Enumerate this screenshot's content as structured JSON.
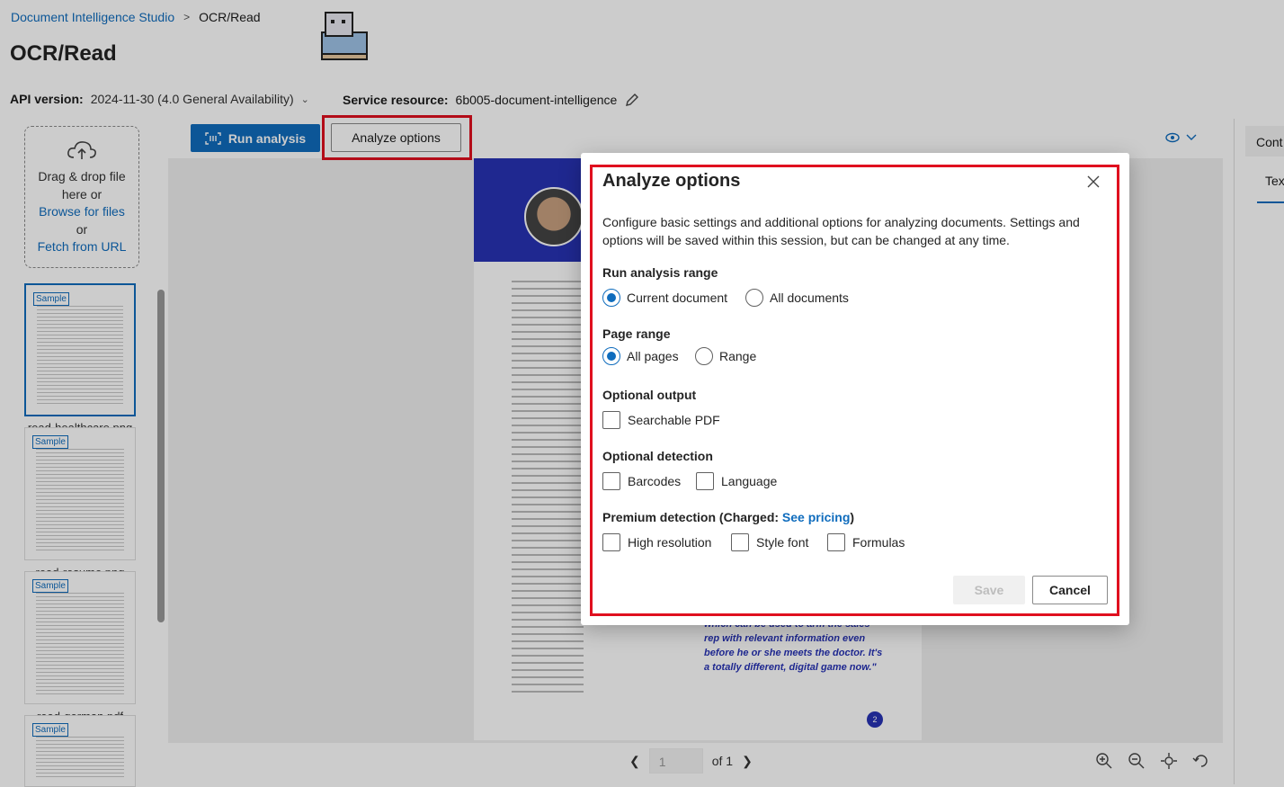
{
  "breadcrumb": {
    "root": "Document Intelligence Studio",
    "current": "OCR/Read"
  },
  "page_title": "OCR/Read",
  "api": {
    "label": "API version:",
    "value": "2024-11-30 (4.0 General Availability)"
  },
  "service": {
    "label": "Service resource:",
    "value": "6b005-document-intelligence"
  },
  "dropzone": {
    "line1": "Drag & drop file",
    "line2": "here or",
    "browse": "Browse for files",
    "or": "or",
    "fetch": "Fetch from URL"
  },
  "samples": [
    {
      "badge": "Sample",
      "name": "read-healthcare.png"
    },
    {
      "badge": "Sample",
      "name": "read-resume.png"
    },
    {
      "badge": "Sample",
      "name": "read-german.pdf"
    },
    {
      "badge": "Sample",
      "name": ""
    }
  ],
  "toolbar": {
    "run_label": "Run analysis",
    "analyze_label": "Analyze options"
  },
  "document": {
    "quote": "which can be used to arm the sales rep with relevant information even before he or she meets the doctor. It's a totally different, digital game now.\"",
    "page_number": "2"
  },
  "pager": {
    "page": "1",
    "of": "of 1"
  },
  "right_panel": {
    "tab": "Cont",
    "subtab": "Tex"
  },
  "modal": {
    "title": "Analyze options",
    "description": "Configure basic settings and additional options for analyzing documents. Settings and options will be saved within this session, but can be changed at any time.",
    "run_range": {
      "label": "Run analysis range",
      "options": [
        "Current document",
        "All documents"
      ],
      "selected": "Current document"
    },
    "page_range": {
      "label": "Page range",
      "options": [
        "All pages",
        "Range"
      ],
      "selected": "All pages"
    },
    "optional_output": {
      "label": "Optional output",
      "options": [
        "Searchable PDF"
      ]
    },
    "optional_detection": {
      "label": "Optional detection",
      "options": [
        "Barcodes",
        "Language"
      ]
    },
    "premium": {
      "label": "Premium detection (Charged: ",
      "link": "See pricing",
      "suffix": ")",
      "options": [
        "High resolution",
        "Style font",
        "Formulas"
      ]
    },
    "save_label": "Save",
    "cancel_label": "Cancel"
  },
  "colors": {
    "accent": "#0f6cbd",
    "highlight": "#e0101f",
    "doc_blue": "#2733b5"
  }
}
